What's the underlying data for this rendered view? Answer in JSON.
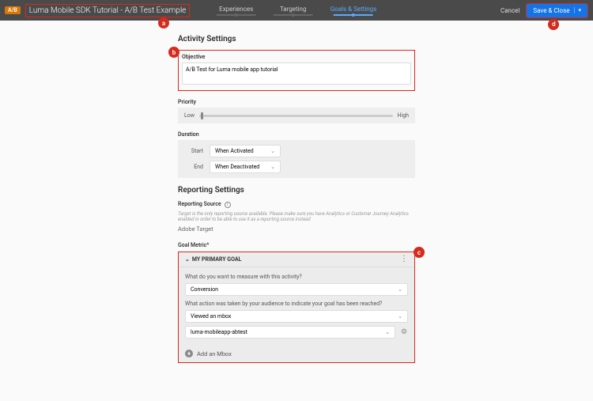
{
  "header": {
    "badge": "A/B",
    "title": "Luma Mobile SDK Tutorial - A/B Test Example",
    "steps": [
      "Experiences",
      "Targeting",
      "Goals & Settings"
    ],
    "active_step": 2,
    "cancel": "Cancel",
    "save": "Save & Close"
  },
  "callouts": {
    "a": "a",
    "b": "b",
    "c": "c",
    "d": "d"
  },
  "activity": {
    "heading": "Activity Settings",
    "objective_label": "Objective",
    "objective_value": "A/B Test for Luma mobile app tutorial",
    "priority_label": "Priority",
    "priority_low": "Low",
    "priority_high": "High",
    "duration_label": "Duration",
    "start_label": "Start",
    "end_label": "End",
    "start_value": "When Activated",
    "end_value": "When Deactivated"
  },
  "reporting": {
    "heading": "Reporting Settings",
    "source_label": "Reporting Source",
    "source_help": "Target is the only reporting source available. Please make sure you have Analytics or Customer Journey Analytics enabled in order to be able to use it as a reporting source instead",
    "source_value": "Adobe Target",
    "goal_metric_label": "Goal Metric*",
    "goal": {
      "title": "MY PRIMARY GOAL",
      "q1": "What do you want to measure with this activity?",
      "measure": "Conversion",
      "q2": "What action was taken by your audience to indicate your goal has been reached?",
      "action": "Viewed an mbox",
      "mbox_value": "luma-mobileapp-abtest",
      "add_mbox": "Add an Mbox"
    }
  }
}
